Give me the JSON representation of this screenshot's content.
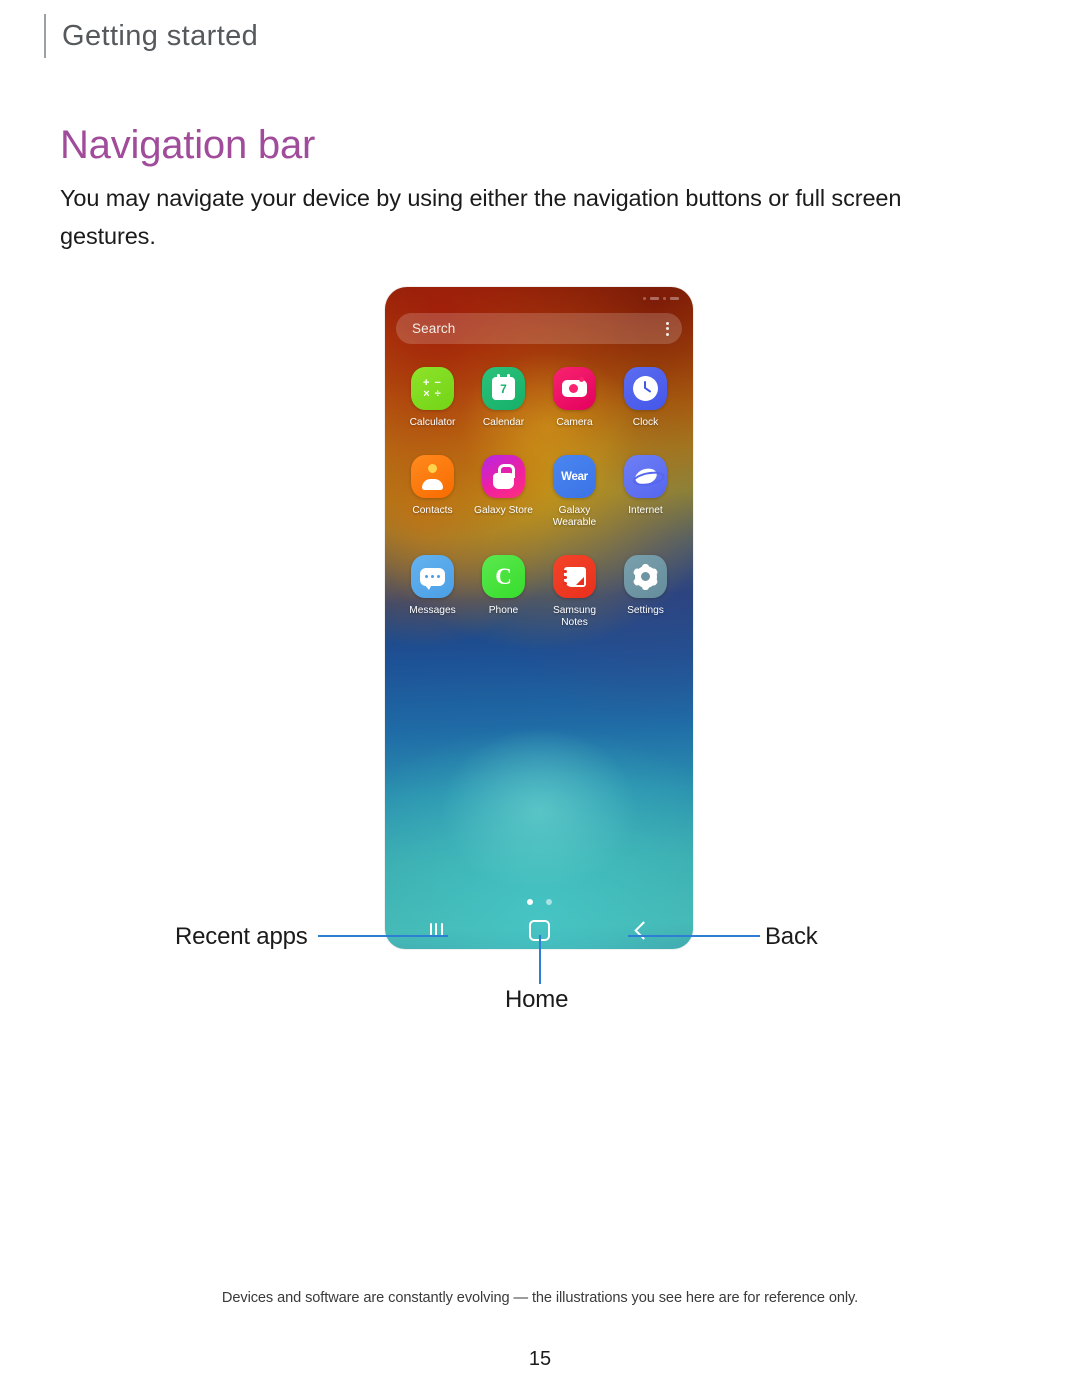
{
  "header": {
    "running_head": "Getting started"
  },
  "page": {
    "title": "Navigation bar",
    "intro": "You may navigate your device by using either the navigation buttons or full screen gestures.",
    "footnote": "Devices and software are constantly evolving — the illustrations you see here are for reference only.",
    "page_number": "15"
  },
  "colors": {
    "title": "#a14b9b",
    "running_head": "#55595c",
    "leader_line": "#2d7fd4",
    "body_text": "#1b1b1b"
  },
  "figure": {
    "phone": {
      "statusbar": {
        "left": "",
        "right": ""
      },
      "search": {
        "placeholder": "Search",
        "menu_icon": "kebab-menu-icon"
      },
      "apps": [
        {
          "name": "Calculator",
          "icon": "calculator-icon",
          "symbol": "+−\n×÷"
        },
        {
          "name": "Calendar",
          "icon": "calendar-icon",
          "symbol": "7"
        },
        {
          "name": "Camera",
          "icon": "camera-icon",
          "symbol": ""
        },
        {
          "name": "Clock",
          "icon": "clock-icon",
          "symbol": ""
        },
        {
          "name": "Contacts",
          "icon": "contacts-icon",
          "symbol": ""
        },
        {
          "name": "Galaxy Store",
          "icon": "galaxy-store-icon",
          "symbol": ""
        },
        {
          "name": "Galaxy Wearable",
          "icon": "galaxy-wearable-icon",
          "symbol": "Wear"
        },
        {
          "name": "Internet",
          "icon": "internet-icon",
          "symbol": ""
        },
        {
          "name": "Messages",
          "icon": "messages-icon",
          "symbol": ""
        },
        {
          "name": "Phone",
          "icon": "phone-icon",
          "symbol": "C"
        },
        {
          "name": "Samsung Notes",
          "icon": "samsung-notes-icon",
          "symbol": ""
        },
        {
          "name": "Settings",
          "icon": "settings-icon",
          "symbol": ""
        }
      ],
      "page_indicator": {
        "total": 2,
        "active": 1
      },
      "nav_buttons": [
        {
          "id": "recent",
          "icon": "recent-apps-icon"
        },
        {
          "id": "home",
          "icon": "home-circle-icon"
        },
        {
          "id": "back",
          "icon": "back-chevron-icon"
        }
      ]
    },
    "callouts": [
      {
        "id": "recent-apps",
        "label": "Recent apps",
        "side": "left"
      },
      {
        "id": "back",
        "label": "Back",
        "side": "right"
      },
      {
        "id": "home",
        "label": "Home",
        "side": "bottom"
      }
    ]
  }
}
